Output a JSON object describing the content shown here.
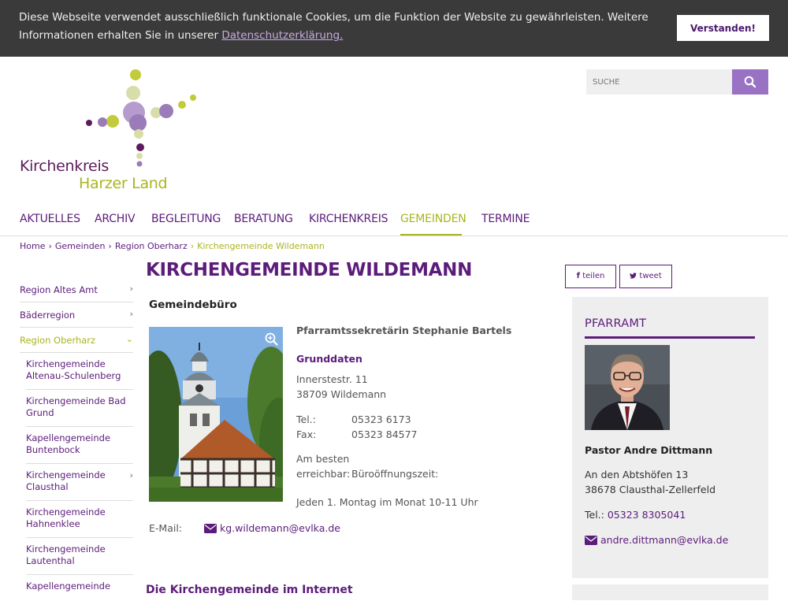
{
  "cookie": {
    "text": "Diese Webseite verwendet ausschließlich funktionale Cookies, um die Funktion der Website zu gewährleisten. Weitere Informationen erhalten Sie in unserer",
    "link": "Datenschutzerklärung.",
    "button": "Verstanden!"
  },
  "logo": {
    "line1": "Kirchenkreis",
    "line2": "Harzer Land"
  },
  "search": {
    "placeholder": "SUCHE",
    "icon": "search-icon"
  },
  "nav": {
    "items": [
      {
        "label": "AKTUELLES"
      },
      {
        "label": "ARCHIV"
      },
      {
        "label": "BEGLEITUNG"
      },
      {
        "label": "BERATUNG"
      },
      {
        "label": "KIRCHENKREIS"
      },
      {
        "label": "GEMEINDEN"
      },
      {
        "label": "TERMINE"
      }
    ],
    "active_index": 5
  },
  "breadcrumb": [
    "Home",
    "Gemeinden",
    "Region Oberharz",
    "Kirchengemeinde Wildemann"
  ],
  "sidebar": {
    "top_items": [
      "Region Altes Amt",
      "Bäderregion",
      "Region Oberharz"
    ],
    "sub_items": [
      "Kirchengemeinde Altenau-Schulenberg",
      "Kirchengemeinde Bad Grund",
      "Kapellengemeinde Buntenbock",
      "Kirchengemeinde Clausthal",
      "Kirchengemeinde Hahnenklee",
      "Kirchengemeinde Lautenthal",
      "Kapellengemeinde"
    ]
  },
  "page": {
    "title": "KIRCHENGEMEINDE WILDEMANN"
  },
  "share": {
    "facebook": "teilen",
    "twitter": "tweet"
  },
  "office": {
    "heading": "Gemeindebüro",
    "secretary": "Pfarramtssekretärin Stephanie Bartels",
    "grunddaten": "Grunddaten",
    "street": "Innerstestr. 11",
    "city": "38709 Wildemann",
    "tel_label": "Tel.:",
    "tel": "05323 6173",
    "fax_label": "Fax:",
    "fax": "05323 84577",
    "reach_label_1": "Am besten",
    "reach_label_2": "erreichbar:",
    "reach_value": "Büroöffnungszeit:",
    "hours": "Jeden 1. Montag im Monat 10-11 Uhr",
    "email_label": "E-Mail:",
    "email": "kg.wildemann@evlka.de"
  },
  "pfarramt": {
    "title": "PFARRAMT",
    "name": "Pastor Andre Dittmann",
    "street": "An den Abtshöfen 13",
    "city": "38678 Clausthal-Zellerfeld",
    "tel_label": "Tel.:",
    "tel": "05323 8305041",
    "email": "andre.dittmann@evlka.de"
  },
  "bottom_heading": "Die Kirchengemeinde im Internet",
  "colors": {
    "primary": "#5b1c7a",
    "accent": "#a8b520",
    "search_button": "#9a72c3",
    "cookie_bar": "#3a3a3a"
  }
}
